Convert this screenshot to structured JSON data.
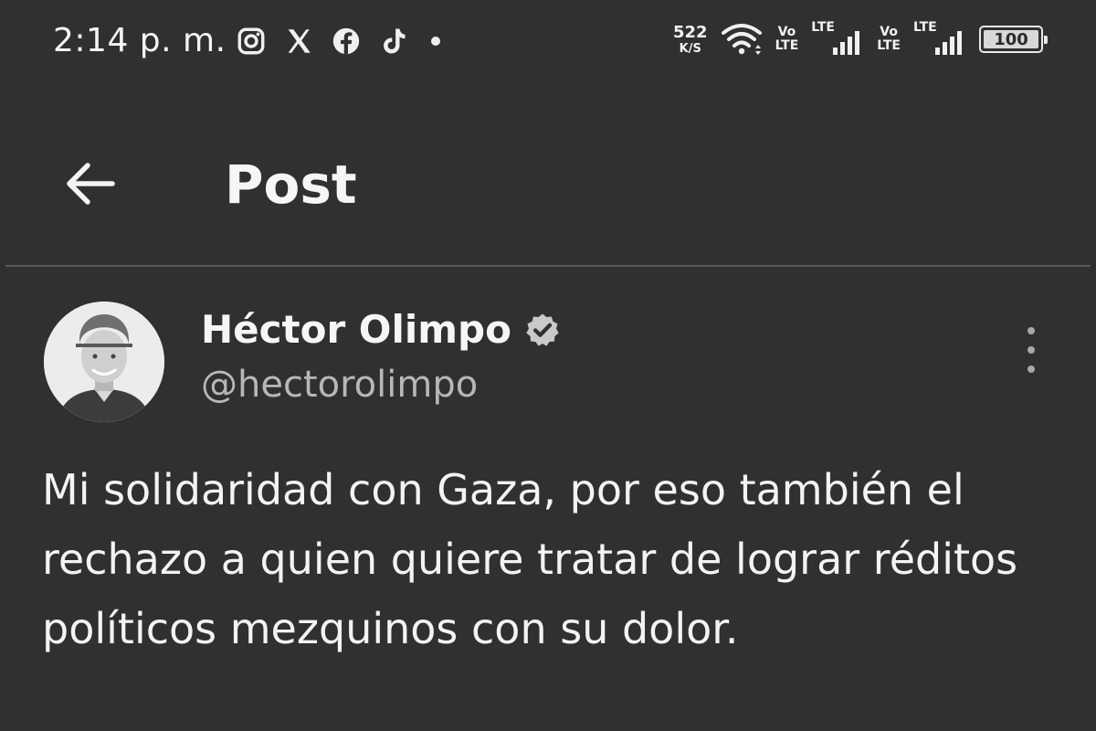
{
  "status_bar": {
    "time": "2:14 p. m.",
    "notification_icons": [
      "instagram-icon",
      "x-icon",
      "facebook-icon",
      "tiktok-icon"
    ],
    "network_rate": "522",
    "network_rate_unit": "K/S",
    "volte_top": "Vo",
    "volte_bottom": "LTE",
    "lte_label": "LTE",
    "battery": "100"
  },
  "header": {
    "title": "Post"
  },
  "post": {
    "author_name": "Héctor Olimpo",
    "author_handle": "@hectorolimpo",
    "text": "Mi solidaridad con Gaza, por eso también el rechazo a quien quiere tratar de lograr réditos políticos mezquinos con su dolor."
  },
  "colors": {
    "background": "#303033",
    "text": "#f3f3f3",
    "secondary_text": "#b7b7b7",
    "divider": "#5a5a5d"
  }
}
